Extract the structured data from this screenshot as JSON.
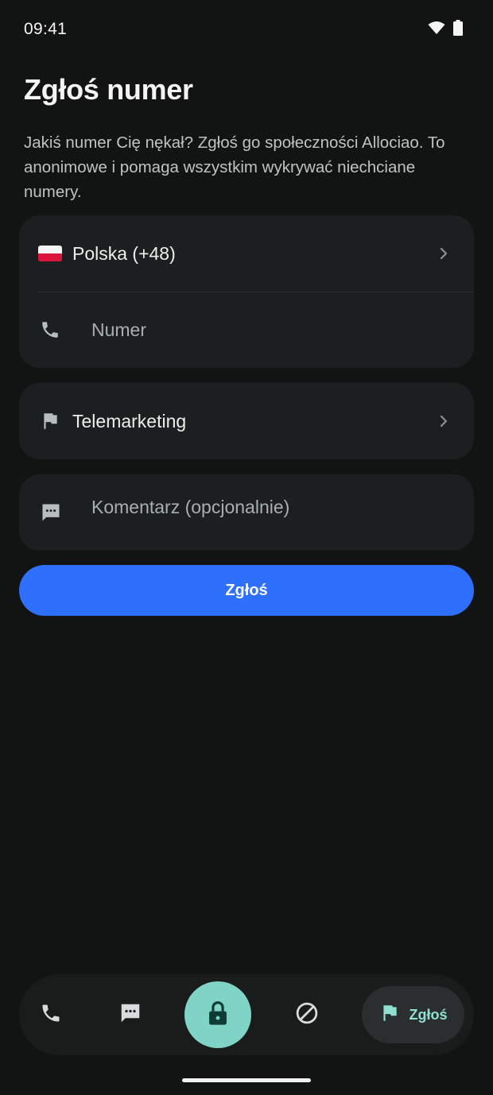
{
  "status_bar": {
    "time": "09:41"
  },
  "header": {
    "title": "Zgłoś numer",
    "description": "Jakiś numer Cię nękał? Zgłoś go społeczności Allociao. To anonimowe i pomaga wszystkim wykrywać niechciane numery."
  },
  "form": {
    "country": {
      "label": "Polska (+48)",
      "flag": "poland-flag"
    },
    "number": {
      "placeholder": "Numer",
      "icon": "phone-icon"
    },
    "category": {
      "label": "Telemarketing",
      "icon": "flag-icon"
    },
    "comment": {
      "placeholder": "Komentarz (opcjonalnie)",
      "icon": "message-icon"
    },
    "submit_label": "Zgłoś"
  },
  "bottom_nav": {
    "items": [
      {
        "icon": "phone-icon"
      },
      {
        "icon": "message-icon"
      },
      {
        "icon": "lock-icon"
      },
      {
        "icon": "block-icon"
      },
      {
        "icon": "flag-icon",
        "label": "Zgłoś",
        "active": true
      }
    ]
  },
  "colors": {
    "background": "#121313",
    "card": "#1c1f1f",
    "accent_blue": "#2e6ffb",
    "accent_teal": "#7fd4c6",
    "active_label": "#8fe0d2"
  }
}
